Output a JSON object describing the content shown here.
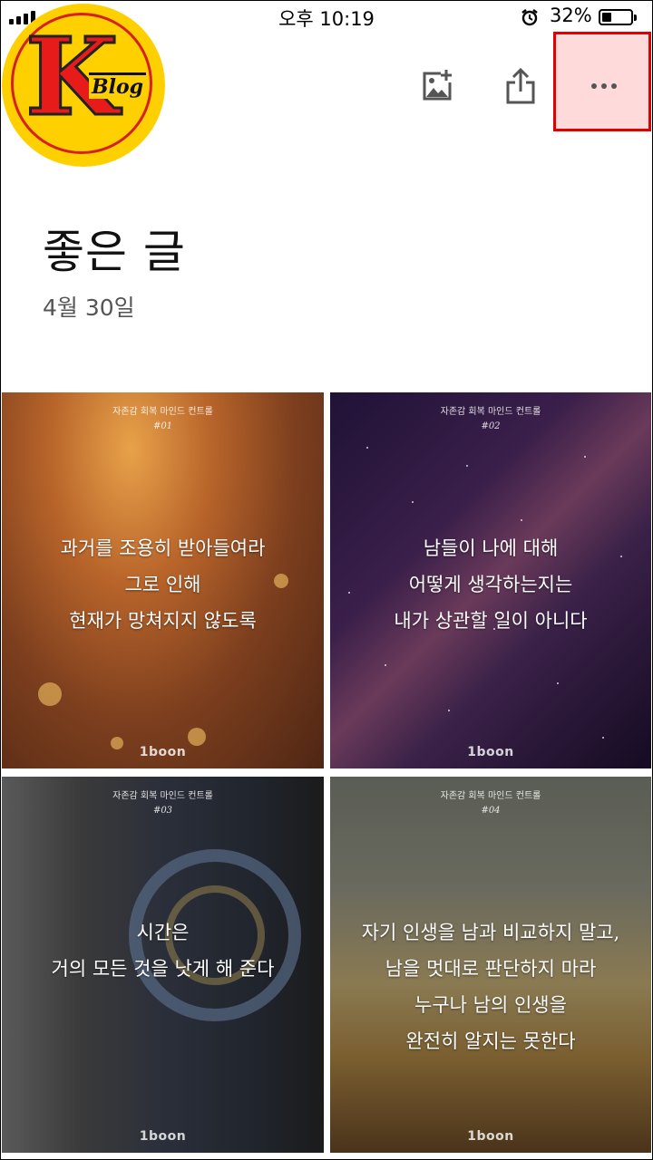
{
  "status_bar": {
    "time": "오후 10:19",
    "battery": "32%"
  },
  "logo": {
    "letter": "K",
    "text": "Blog"
  },
  "album": {
    "title": "좋은 글",
    "date": "4월 30일"
  },
  "toolbar": {
    "add_photo": "add-photo-icon",
    "share": "share-icon",
    "more": "more-icon"
  },
  "photos": [
    {
      "series": "자존감 회복 마인드 컨트롤",
      "number": "#01",
      "lines": [
        "과거를 조용히 받아들여라",
        "그로 인해",
        "현재가 망쳐지지 않도록"
      ],
      "brand": "1boon"
    },
    {
      "series": "자존감 회복 마인드 컨트롤",
      "number": "#02",
      "lines": [
        "남들이 나에 대해",
        "어떻게 생각하는지는",
        "내가 상관할 일이 아니다"
      ],
      "brand": "1boon"
    },
    {
      "series": "자존감 회복 마인드 컨트롤",
      "number": "#03",
      "lines": [
        "시간은",
        "거의 모든 것을 낫게 해 준다"
      ],
      "brand": "1boon"
    },
    {
      "series": "자존감 회복 마인드 컨트롤",
      "number": "#04",
      "lines": [
        "자기 인생을 남과 비교하지 말고,",
        "남을 멋대로 판단하지 마라",
        "누구나 남의 인생을",
        "완전히 알지는 못한다"
      ],
      "brand": "1boon"
    }
  ]
}
